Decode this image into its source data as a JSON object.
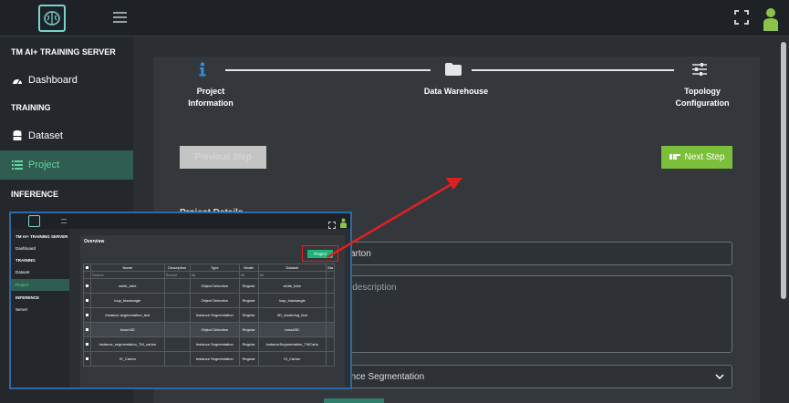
{
  "header": {
    "logo": "brain-logo",
    "menu_icon": "hamburger-icon",
    "expand_icon": "fullscreen-icon",
    "user_icon": "user-icon"
  },
  "sidebar": {
    "server_title": "TM AI+ TRAINING SERVER",
    "dashboard": "Dashboard",
    "training_title": "TRAINING",
    "dataset": "Dataset",
    "project": "Project",
    "inference_title": "INFERENCE"
  },
  "steps": {
    "step1_line1": "Project",
    "step1_line2": "Information",
    "step2": "Data Warehouse",
    "step3_line1": "Topology",
    "step3_line2": "Configuration"
  },
  "buttons": {
    "prev": "Previous Step",
    "next": "Next Step"
  },
  "form": {
    "section_title": "Project Details",
    "name_value": "carton",
    "desc_placeholder": "il description",
    "type_value": "ance Segmentation"
  },
  "inset": {
    "server_title": "TM AI+ TRAINING SERVER",
    "dashboard": "Dashboard",
    "training_title": "TRAINING",
    "dataset": "Dataset",
    "project": "Project",
    "inference_title": "INFERENCE",
    "server": "Server",
    "overview": "Overview",
    "project_button": "Project",
    "columns": [
      "Name",
      "Description",
      "Type",
      "Model",
      "Dataset",
      "Sta"
    ],
    "search_placeholder": "Search",
    "all": "All",
    "rows": [
      [
        "white_tube",
        "",
        "Object Detection",
        "Regular",
        "white_tube"
      ],
      [
        "loup_blackangle",
        "",
        "Object Detection",
        "Regular",
        "loup_blackangle"
      ],
      [
        "Instance segmentation_test",
        "",
        "Instance Segmentation",
        "Regular",
        "3D_clustering_test"
      ],
      [
        "bosch3D",
        "",
        "Object Detection",
        "Regular",
        "bosch3D"
      ],
      [
        "Instance_segmentation_TM_carton",
        "",
        "Instance Segmentation",
        "Regular",
        "InstanceSegmentation_TMCarto"
      ],
      [
        "IS_Carton",
        "",
        "Instance Segmentation",
        "Regular",
        "IS_Carton"
      ]
    ]
  },
  "colors": {
    "accent_green": "#7cbf3a",
    "active_text": "#63d69b",
    "arrow_red": "#e02020"
  }
}
